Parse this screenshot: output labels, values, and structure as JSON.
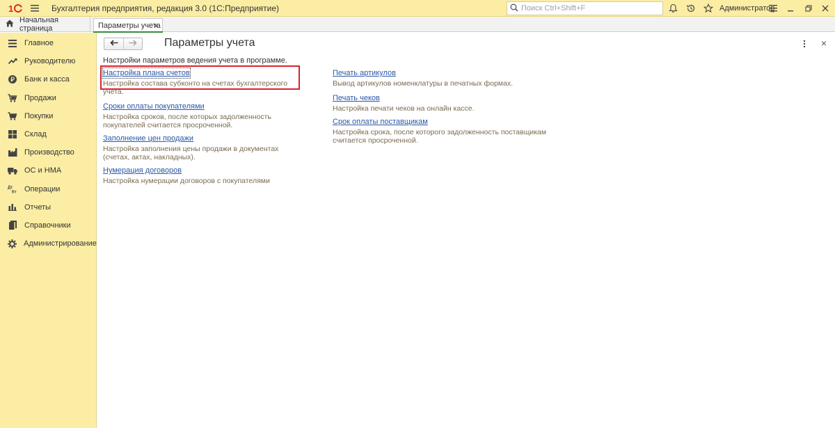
{
  "titlebar": {
    "app_title": "Бухгалтерия предприятия, редакция 3.0  (1С:Предприятие)",
    "search_placeholder": "Поиск Ctrl+Shift+F",
    "user": "Администратор"
  },
  "tabs": {
    "home": "Начальная страница",
    "active": "Параметры учета",
    "close_glyph": "×"
  },
  "sidebar": {
    "items": [
      {
        "label": "Главное",
        "icon": "list-icon"
      },
      {
        "label": "Руководителю",
        "icon": "trend-icon"
      },
      {
        "label": "Банк и касса",
        "icon": "ruble-coin-icon"
      },
      {
        "label": "Продажи",
        "icon": "cart-arrow-icon"
      },
      {
        "label": "Покупки",
        "icon": "cart-icon"
      },
      {
        "label": "Склад",
        "icon": "warehouse-icon"
      },
      {
        "label": "Производство",
        "icon": "factory-icon"
      },
      {
        "label": "ОС и НМА",
        "icon": "truck-icon"
      },
      {
        "label": "Операции",
        "icon": "dt-kt-icon"
      },
      {
        "label": "Отчеты",
        "icon": "bar-chart-icon"
      },
      {
        "label": "Справочники",
        "icon": "book-icon"
      },
      {
        "label": "Администрирование",
        "icon": "gear-icon"
      }
    ]
  },
  "main": {
    "title": "Параметры учета",
    "subtitle": "Настройки параметров ведения учета в программе.",
    "close_glyph": "×",
    "left_settings": [
      {
        "link": "Настройка плана счетов",
        "desc": "Настройка состава субконто на счетах бухгалтерского учета."
      },
      {
        "link": "Сроки оплаты покупателями",
        "desc": "Настройка сроков, после которых задолженность покупателей считается просроченной."
      },
      {
        "link": "Заполнение цен продажи",
        "desc": "Настройка заполнения цены продажи в документах (счетах, актах, накладных)."
      },
      {
        "link": "Нумерация договоров",
        "desc": "Настройка нумерации договоров с покупателями"
      }
    ],
    "right_settings": [
      {
        "link": "Печать артикулов",
        "desc": "Вывод артикулов номенклатуры в печатных формах."
      },
      {
        "link": "Печать чеков",
        "desc": "Настройка печати чеков на онлайн кассе."
      },
      {
        "link": "Срок оплаты поставщикам",
        "desc": "Настройка срока, после которого задолженность поставщикам считается просроченной."
      }
    ]
  },
  "colors": {
    "sidebar_bg": "#fbeda4",
    "link": "#2a58a8",
    "desc": "#7a6a50",
    "highlight": "#d9232b"
  }
}
